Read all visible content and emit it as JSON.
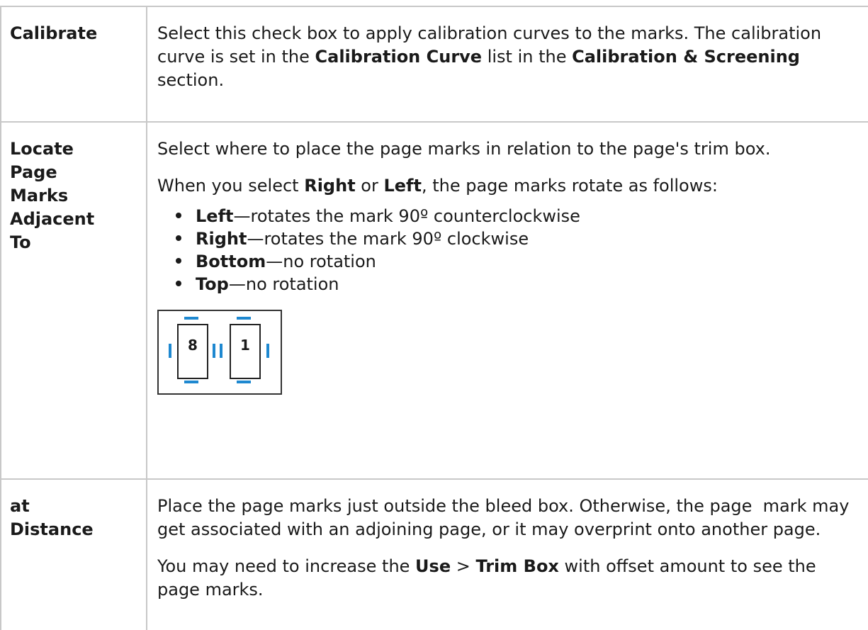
{
  "rows": [
    {
      "term": "Calibrate",
      "desc": [
        {
          "t": "Select this check box to apply calibration curves to the marks. The calibration curve is set in the "
        },
        {
          "b": "Calibration Curve"
        },
        {
          "t": " list in the "
        },
        {
          "b": "Calibration & Screening"
        },
        {
          "t": " section."
        }
      ]
    },
    {
      "term_lines": [
        "Locate",
        "Page",
        "Marks",
        "Adjacent",
        "To"
      ],
      "p1": "Select where to place the page marks in relation to the page's trim box.",
      "p2": {
        "a": "When you select ",
        "b1": "Right",
        "c": " or ",
        "b2": "Left",
        "d": ", the page marks rotate as follows:"
      },
      "bullets": [
        {
          "b": "Left",
          "t": "—rotates the mark 90º counterclockwise"
        },
        {
          "b": "Right",
          "t": "—rotates the mark 90º clockwise"
        },
        {
          "b": "Bottom",
          "t": "—no rotation"
        },
        {
          "b": "Top",
          "t": "—no rotation"
        }
      ],
      "figure": {
        "page_a": "8",
        "page_b": "1",
        "mark_color": "#1e88d0"
      }
    },
    {
      "term_lines": [
        "at",
        "Distance"
      ],
      "p1": "Place the page marks just outside the bleed box. Otherwise, the page  mark may get associated with an adjoining page, or it may overprint onto another page.",
      "p2": {
        "a": "You may need to increase the ",
        "b1": "Use",
        "c": " > ",
        "b2": "Trim Box",
        "d": " with offset amount to see the page marks."
      }
    }
  ]
}
